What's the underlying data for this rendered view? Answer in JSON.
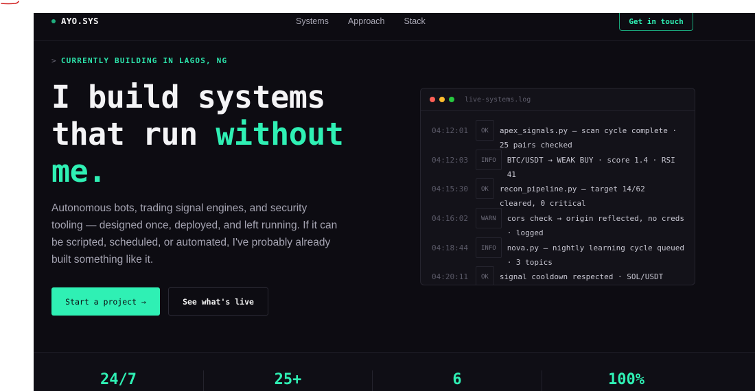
{
  "brand": {
    "name": "AYO.SYS"
  },
  "nav": {
    "links": [
      "Systems",
      "Approach",
      "Stack"
    ],
    "cta_label": "Get in touch"
  },
  "hero": {
    "eyebrow_prompt": ">",
    "eyebrow": "CURRENTLY BUILDING IN LAGOS, NG",
    "title_line1": "I build systems",
    "title_line2_pre": "that run ",
    "title_line2_accent": "without",
    "title_line3": "me.",
    "description": "Autonomous bots, trading signal engines, and security tooling — designed once, deployed, and left running. If it can be scripted, scheduled, or automated, I've probably already built something like it.",
    "primary_button": "Start a project →",
    "secondary_button": "See what's live"
  },
  "terminal": {
    "title": "live-systems.log",
    "lines": [
      {
        "time": "04:12:01",
        "level": "OK",
        "message": "apex_signals.py — scan cycle complete · 25 pairs checked"
      },
      {
        "time": "04:12:03",
        "level": "INFO",
        "message": "BTC/USDT → WEAK BUY · score 1.4 · RSI 41"
      },
      {
        "time": "04:15:30",
        "level": "OK",
        "message": "recon_pipeline.py — target 14/62 cleared, 0 critical"
      },
      {
        "time": "04:16:02",
        "level": "WARN",
        "message": "cors check → origin reflected, no creds · logged"
      },
      {
        "time": "04:18:44",
        "level": "INFO",
        "message": "nova.py — nightly learning cycle queued · 3 topics"
      },
      {
        "time": "04:20:11",
        "level": "OK",
        "message": "signal cooldown respected · SOL/USDT"
      }
    ]
  },
  "stats": [
    "24/7",
    "25+",
    "6",
    "100%"
  ],
  "colors": {
    "accent": "#2ff0b4",
    "background": "#0d0c12",
    "terminal_red": "#ff5f56",
    "terminal_yellow": "#ffbd2e",
    "terminal_green": "#27c93f"
  }
}
